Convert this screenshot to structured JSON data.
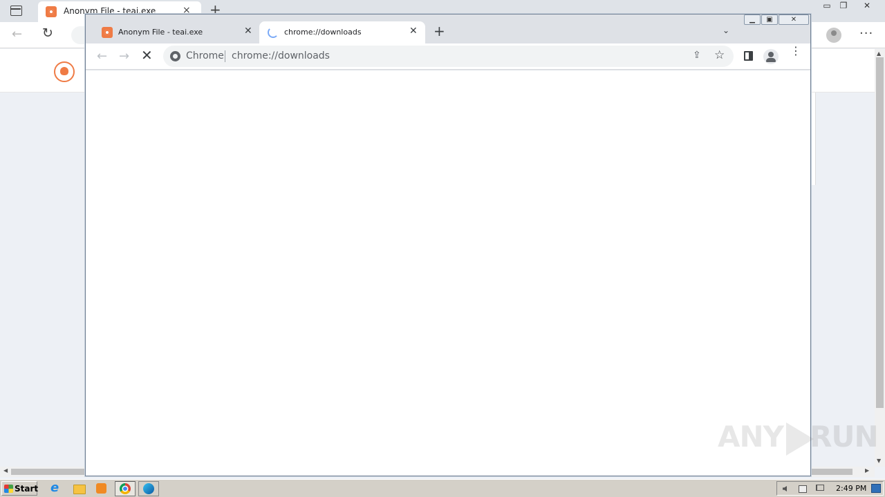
{
  "edge": {
    "tab_title": "Anonym File - teai.exe",
    "tab_close": "×",
    "new_tab": "+",
    "controls": {
      "minimize": "▭",
      "restore": "❐",
      "close": "✕"
    },
    "back": "←",
    "reload": "↻",
    "menu": "···"
  },
  "chrome": {
    "window_controls": {
      "minimize": "▁",
      "restore": "▣",
      "close": "✕"
    },
    "tabs": [
      {
        "title": "Anonym File - teai.exe",
        "close": "✕",
        "state": "inactive"
      },
      {
        "title": "chrome://downloads",
        "close": "✕",
        "state": "active-loading"
      }
    ],
    "new_tab": "+",
    "tab_search": "⌄",
    "toolbar": {
      "back": "←",
      "forward": "→",
      "stop": "✕",
      "scheme_label": "Chrome",
      "url": "chrome://downloads",
      "share": "⇪",
      "star": "☆",
      "menu": "⋮"
    }
  },
  "watermark": {
    "text_left": "ANY",
    "text_right": "RUN"
  },
  "taskbar": {
    "start_label": "Start",
    "clock": "2:49 PM"
  },
  "colors": {
    "edge_accent": "#ef7b45",
    "chrome_tab_bar": "#dee1e6",
    "taskbar": "#d4d0c8"
  }
}
